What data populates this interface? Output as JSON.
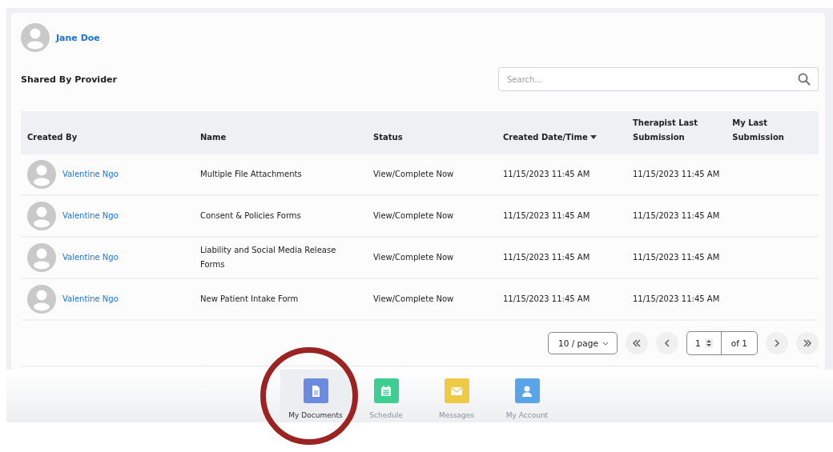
{
  "user": {
    "name": "Jane Doe"
  },
  "section_title": "Shared By Provider",
  "search": {
    "placeholder": "Search..."
  },
  "table": {
    "columns": [
      {
        "label": "Created By",
        "sorted": false
      },
      {
        "label": "Name",
        "sorted": false
      },
      {
        "label": "Status",
        "sorted": false
      },
      {
        "label": "Created Date/Time",
        "sorted": true
      },
      {
        "label": "Therapist Last Submission",
        "sorted": false
      },
      {
        "label": "My Last Submission",
        "sorted": false
      }
    ],
    "rows": [
      {
        "created_by": "Valentine Ngo",
        "name": "Multiple File Attachments",
        "status": "View/Complete Now",
        "created": "11/15/2023 11:45 AM",
        "therapist_last": "11/15/2023 11:45 AM"
      },
      {
        "created_by": "Valentine Ngo",
        "name": "Consent & Policies Forms",
        "status": "View/Complete Now",
        "created": "11/15/2023 11:45 AM",
        "therapist_last": "11/15/2023 11:45 AM"
      },
      {
        "created_by": "Valentine Ngo",
        "name": "Liability and Social Media Release Forms",
        "status": "View/Complete Now",
        "created": "11/15/2023 11:45 AM",
        "therapist_last": "11/15/2023 11:45 AM"
      },
      {
        "created_by": "Valentine Ngo",
        "name": "New Patient Intake Form",
        "status": "View/Complete Now",
        "created": "11/15/2023 11:45 AM",
        "therapist_last": "11/15/2023 11:45 AM"
      }
    ]
  },
  "pagination": {
    "page_size": "10 / page",
    "page": "1",
    "total": "of 1"
  },
  "nav": [
    {
      "label": "My Documents",
      "kind": "document",
      "color": "#6b8cde",
      "selected": true,
      "circled": true
    },
    {
      "label": "Schedule",
      "kind": "calendar",
      "color": "#3ccf91",
      "selected": false,
      "circled": false
    },
    {
      "label": "Messages",
      "kind": "envelope",
      "color": "#f0c945",
      "selected": false,
      "circled": false
    },
    {
      "label": "My Account",
      "kind": "person",
      "color": "#5aa5e8",
      "selected": false,
      "circled": false
    }
  ]
}
